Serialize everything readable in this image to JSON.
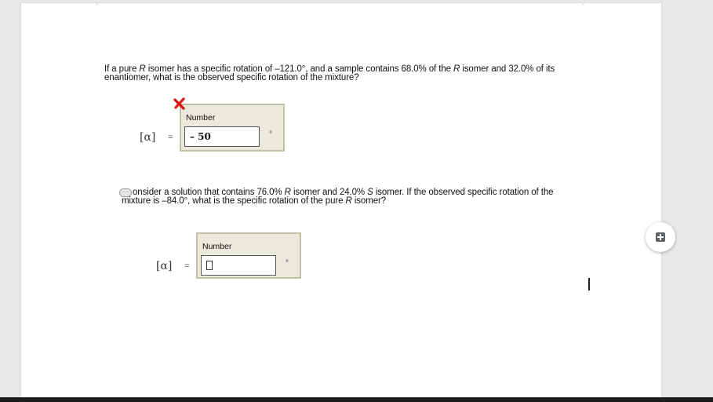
{
  "question1": {
    "text_parts": [
      "If a pure ",
      "R",
      " isomer has a specific rotation of –121.0°, and a sample contains 68.0% of the ",
      "R",
      " isomer and 32.0% of its enantiomer, what is the observed specific rotation of the mixture?"
    ],
    "alpha_symbol": "[α]",
    "equals": "=",
    "label": "Number",
    "value": "– 50",
    "unit": "°",
    "status": "incorrect",
    "status_icon": "x-mark-icon",
    "status_color": "#e0221c"
  },
  "question2": {
    "text_parts": [
      "onsider a solution that contains 76.0% ",
      "R",
      " isomer and 24.0% ",
      "S",
      " isomer. If the observed specific rotation of the mixture is –84.0°, what is the specific rotation of the pure ",
      "R",
      " isomer?"
    ],
    "alpha_symbol": "[α]",
    "equals": "=",
    "label": "Number",
    "value": "",
    "unit": "°"
  },
  "colors": {
    "answer_box_bg": "#eae9dc",
    "answer_box_border": "#c2c0a6",
    "page_bg": "#ffffff",
    "workspace_bg": "#e8e8e8"
  },
  "icons": {
    "add_comment": "add-comment-icon",
    "comment": "comment-icon"
  }
}
